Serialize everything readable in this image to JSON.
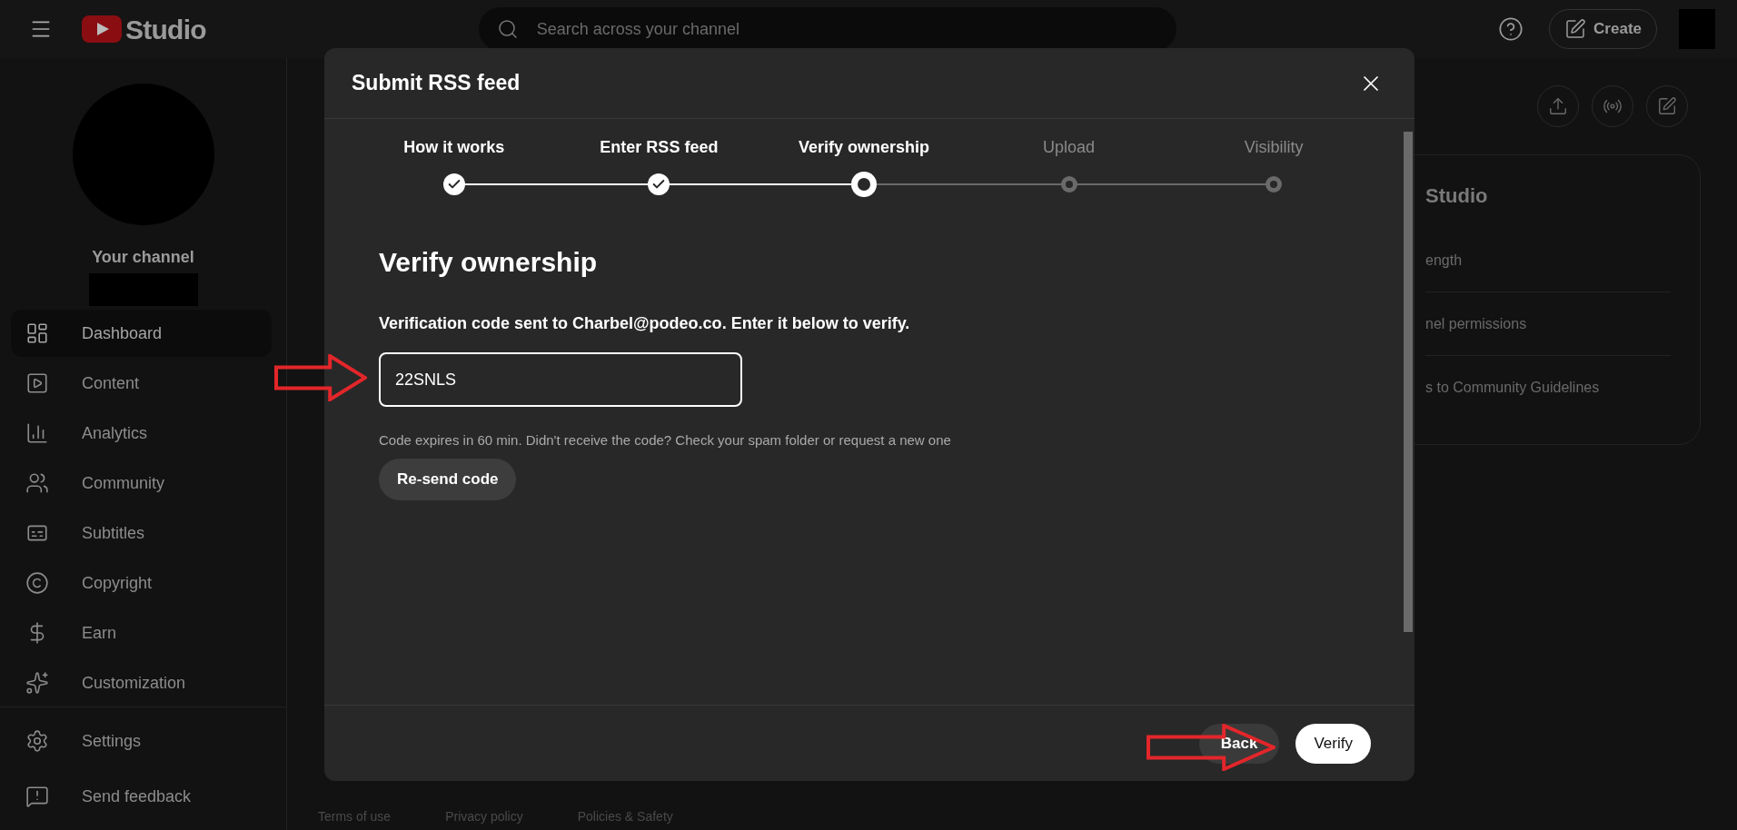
{
  "topbar": {
    "logo_text": "Studio",
    "search": {
      "placeholder": "Search across your channel"
    },
    "create_button": "Create"
  },
  "sidebar": {
    "channel_label": "Your channel",
    "items": [
      {
        "label": "Dashboard",
        "selected": true
      },
      {
        "label": "Content",
        "selected": false
      },
      {
        "label": "Analytics",
        "selected": false
      },
      {
        "label": "Community",
        "selected": false
      },
      {
        "label": "Subtitles",
        "selected": false
      },
      {
        "label": "Copyright",
        "selected": false
      },
      {
        "label": "Earn",
        "selected": false
      },
      {
        "label": "Customization",
        "selected": false
      }
    ],
    "footer_items": [
      "Settings",
      "Send feedback"
    ]
  },
  "background": {
    "card_title": "Studio",
    "card_items": [
      "ength",
      "nel permissions",
      "s to Community Guidelines"
    ],
    "footer_links": [
      "Terms of use",
      "Privacy policy",
      "Policies & Safety"
    ]
  },
  "dialog": {
    "title": "Submit RSS feed",
    "steps": [
      {
        "label": "How it works",
        "completed": true,
        "selected": false
      },
      {
        "label": "Enter RSS feed",
        "completed": true,
        "selected": false
      },
      {
        "label": "Verify ownership",
        "completed": false,
        "selected": true
      },
      {
        "label": "Upload",
        "completed": false,
        "selected": false
      },
      {
        "label": "Visibility",
        "completed": false,
        "selected": false
      }
    ],
    "heading": "Verify ownership",
    "instruction": "Verification code sent to **Charbel@podeo.co**. Enter it below to verify.",
    "code_field": {
      "value": "22SNLS"
    },
    "hint": "Code expires in 60 min. Didn't receive the code? Check your spam folder or request a new one",
    "resend_button": "Re-send code",
    "back_button": "Back",
    "verify_button": "Verify"
  }
}
